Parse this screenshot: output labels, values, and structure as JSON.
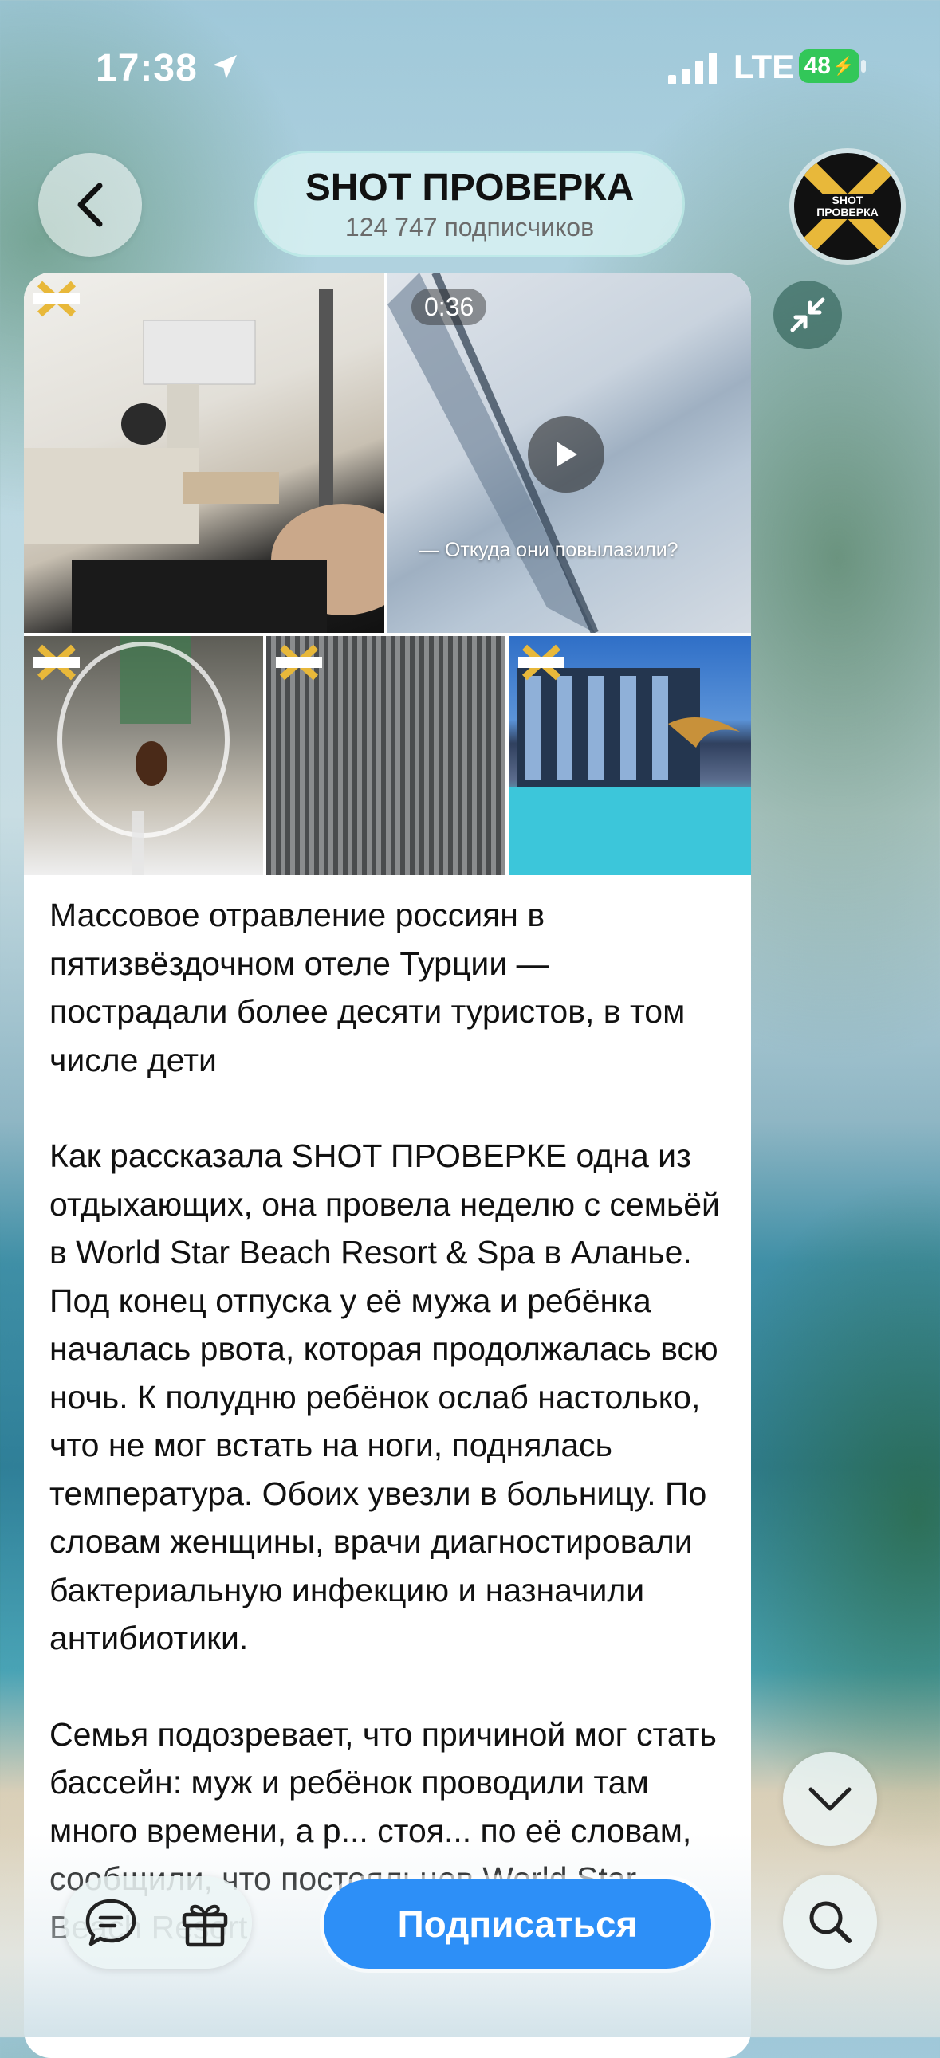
{
  "status_bar": {
    "time": "17:38",
    "network": "LTE",
    "battery": "48"
  },
  "header": {
    "channel_name": "SHOT ПРОВЕРКА",
    "subscribers": "124 747 подписчиков",
    "avatar_text": "SHOT ПРОВЕРКА"
  },
  "post": {
    "video_duration": "0:36",
    "video_caption": "— Откуда они повылазили?",
    "paragraphs": [
      "Массовое отравление россиян в пятизвёздочном отеле Турции — пострадали более десяти туристов, в том числе дети",
      "Как рассказала SHOT ПРОВЕРКЕ одна из отдыхающих, она провела неделю с семьёй в World Star Beach Resort & Spa в Аланье. Под конец отпуска у её мужа и ребёнка началась рвота, которая продолжалась всю ночь. К полудню ребёнок ослаб настолько, что не мог встать на ноги, поднялась температура. Обоих увезли в больницу. По словам женщины, врачи диагностировали бактериальную инфекцию и назначили антибиотики.",
      "Семья подозревает, что причиной мог стать бассейн: муж и ребёнок проводили там много времени, а р... стоя... по её словам, сообщили, что постояльцев World Star Beach Resort"
    ]
  },
  "bottom": {
    "subscribe_label": "Подписаться"
  },
  "icons": {
    "back": "chevron-left-icon",
    "collapse": "collapse-arrows-icon",
    "comments": "comment-icon",
    "gift": "gift-icon",
    "scroll_down": "chevron-down-icon",
    "search": "search-icon"
  },
  "colors": {
    "accent": "#2d8ff7",
    "battery": "#32c759"
  }
}
